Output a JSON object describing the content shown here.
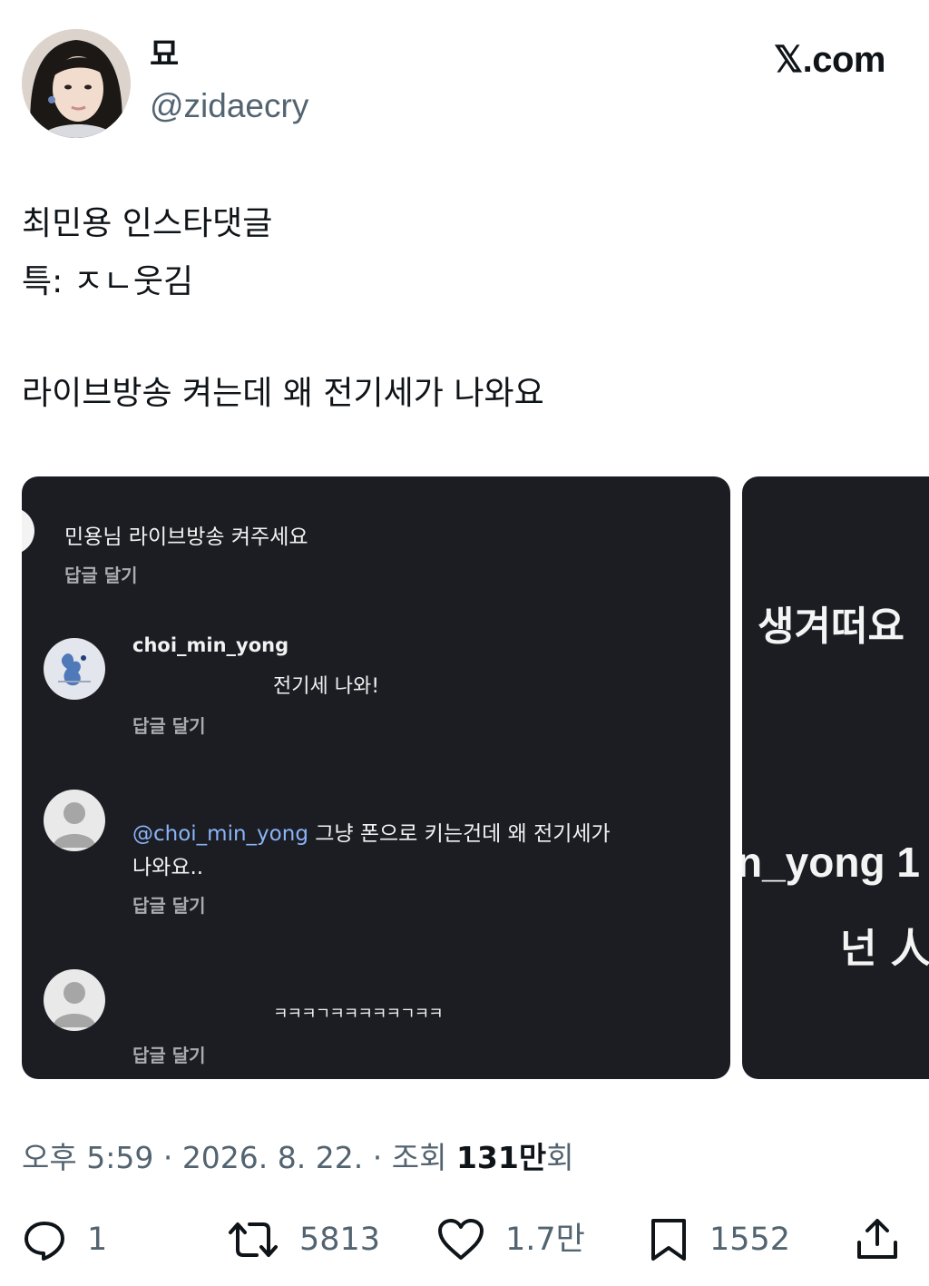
{
  "header": {
    "display_name": "묘",
    "handle": "@zidaecry",
    "brand": "𝕏.com"
  },
  "tweet": {
    "lines": [
      "최민용 인스타댓글",
      "특: ㅈㄴ웃김",
      "라이브방송 켜는데 왜 전기세가 나와요"
    ]
  },
  "media": {
    "main": {
      "top_comment": "민용님 라이브방송 켜주세요",
      "reply_label": "답글 달기",
      "comments": [
        {
          "username": "choi_min_yong",
          "text": "전기세 나와!",
          "avatar": "drawing-avatar"
        },
        {
          "mention": "@choi_min_yong",
          "text_line1": "그냥 폰으로 키는건데 왜 전기세가",
          "text_line2": "나와요..",
          "avatar": "default-avatar"
        },
        {
          "text": "ㅋㅋㅋㄱㅋㅋㅋㅋㅋㄱㅋㅋ",
          "avatar": "default-avatar"
        }
      ]
    },
    "side": {
      "text1": "생겨떠요",
      "text2": "n_yong 1",
      "text3": "넌 人"
    }
  },
  "meta": {
    "time": "오후 5:59",
    "separator": " · ",
    "date": "2026. 8. 22.",
    "views_label": "조회",
    "views_count": "131만",
    "views_suffix": "회"
  },
  "actions": {
    "replies": "1",
    "reposts": "5813",
    "likes": "1.7만",
    "bookmarks": "1552"
  },
  "colors": {
    "text_primary": "#0f1419",
    "text_secondary": "#536471",
    "media_background": "#1b1d22",
    "mention_link": "#8ab4f8"
  }
}
